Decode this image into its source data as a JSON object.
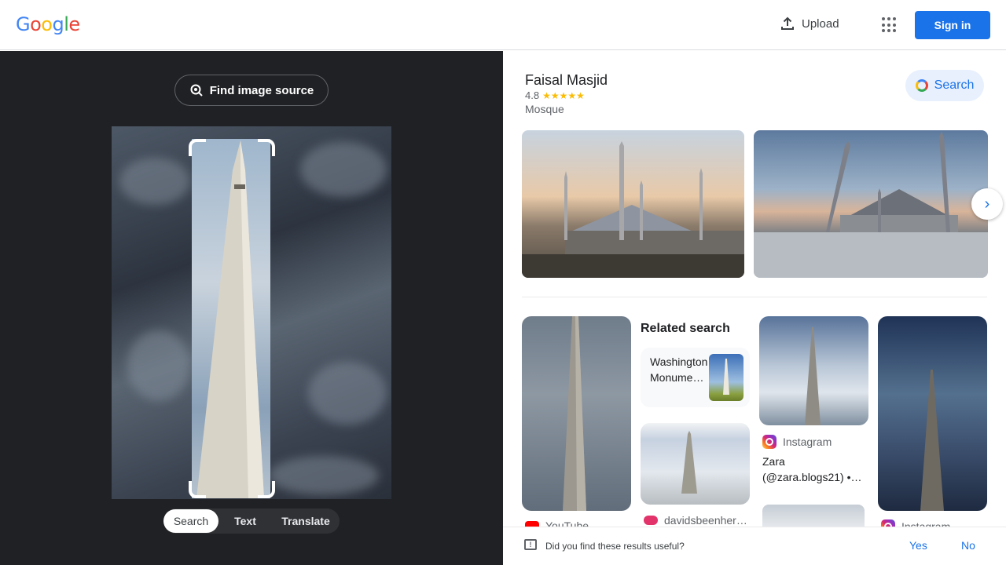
{
  "header": {
    "logo": [
      "G",
      "o",
      "o",
      "g",
      "l",
      "e"
    ],
    "logo_colors": [
      "#4285f4",
      "#ea4335",
      "#fbbc05",
      "#4285f4",
      "#34a853",
      "#ea4335"
    ],
    "upload_label": "Upload",
    "signin_label": "Sign in"
  },
  "left": {
    "find_source_label": "Find image source",
    "modes": [
      {
        "label": "Search",
        "active": true
      },
      {
        "label": "Text",
        "active": false
      },
      {
        "label": "Translate",
        "active": false
      }
    ]
  },
  "knowledge_panel": {
    "title": "Faisal Masjid",
    "rating": "4.8",
    "stars": "★★★★★",
    "type": "Mosque",
    "search_label": "Search"
  },
  "results": {
    "related_title": "Related search",
    "related_card_text": "Washington Monume…",
    "instagram_source": "Instagram",
    "instagram_caption": "Zara (@zara.blogs21) •…",
    "youtube_source": "YouTube",
    "davids_source": "davidsbeenher…",
    "instagram_source_2": "Instagram"
  },
  "feedback": {
    "question": "Did you find these results useful?",
    "yes": "Yes",
    "no": "No"
  },
  "colors": {
    "accent": "#1a73e8",
    "left_bg": "#202124",
    "star": "#fbbc04"
  }
}
